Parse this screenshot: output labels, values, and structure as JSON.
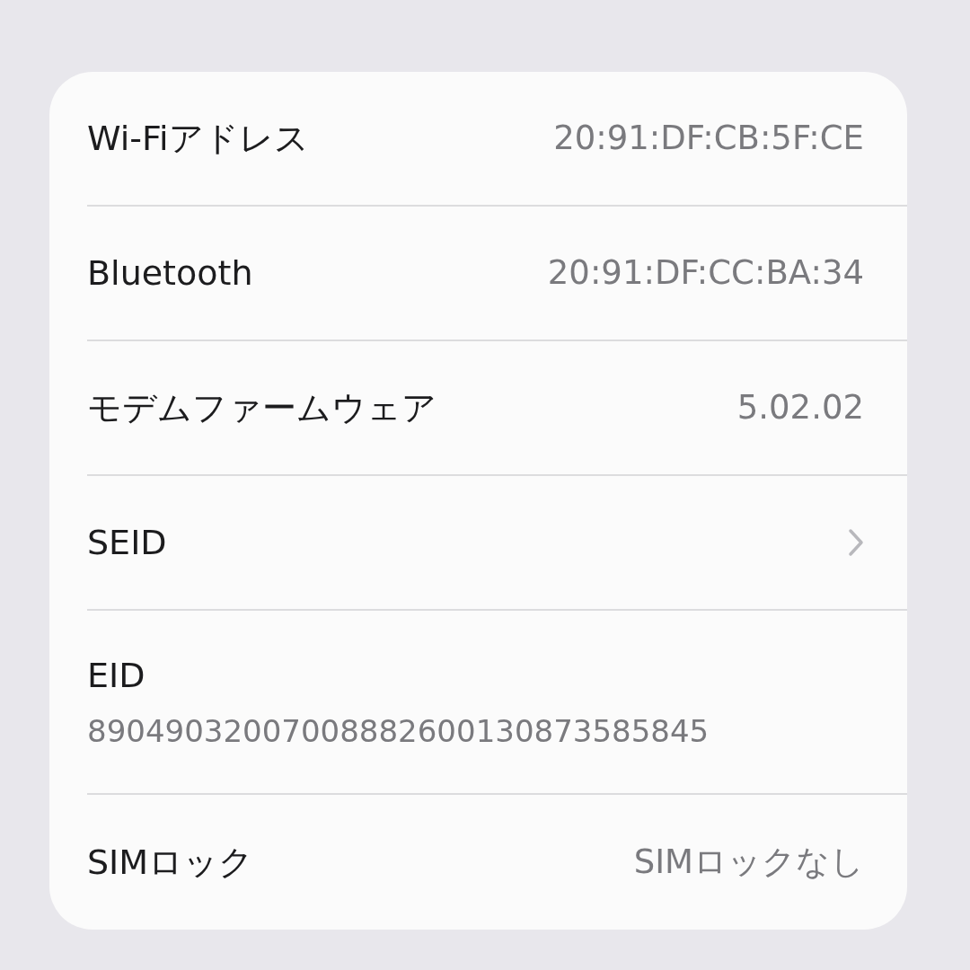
{
  "rows": [
    {
      "kind": "value",
      "label": "Wi-Fiアドレス",
      "value": "20:91:DF:CB:5F:CE"
    },
    {
      "kind": "value",
      "label": "Bluetooth",
      "value": "20:91:DF:CC:BA:34"
    },
    {
      "kind": "value",
      "label": "モデムファームウェア",
      "value": "5.02.02"
    },
    {
      "kind": "link",
      "label": "SEID"
    },
    {
      "kind": "stacked",
      "label": "EID",
      "value": "89049032007008882600130873585845"
    },
    {
      "kind": "value",
      "label": "SIMロック",
      "value": "SIMロックなし"
    }
  ]
}
